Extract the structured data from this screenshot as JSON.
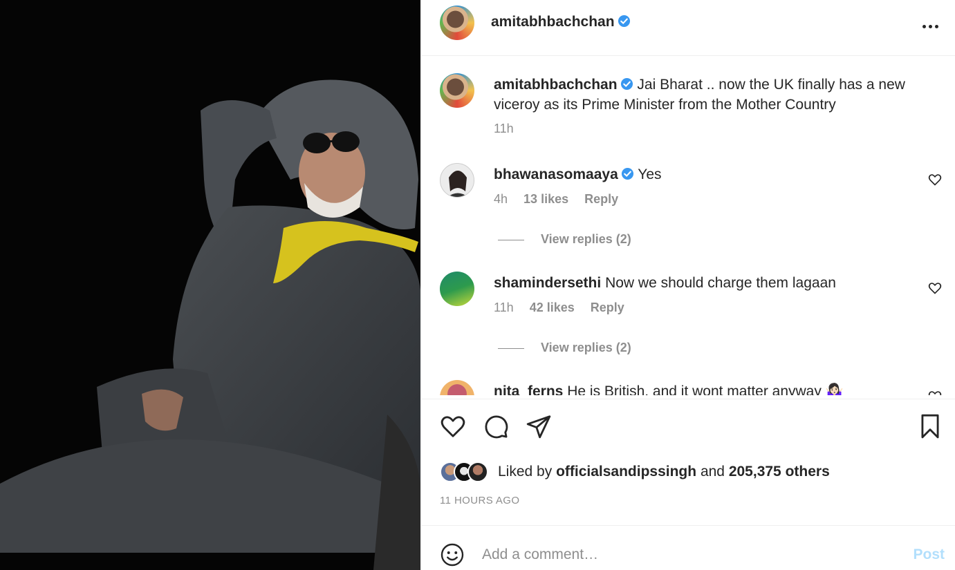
{
  "post": {
    "username": "amitabhbachchan",
    "more_icon": "more-horizontal-icon"
  },
  "caption": {
    "username": "amitabhbachchan",
    "text_line1": "Jai Bharat .. now the UK finally has a new",
    "text_line2": "viceroy as its Prime Minister from the Mother Country",
    "time": "11h"
  },
  "comments": [
    {
      "username": "bhawanasomaaya",
      "verified": true,
      "text": "Yes",
      "time": "4h",
      "likes": "13 likes",
      "reply": "Reply",
      "view_replies": "View replies (2)"
    },
    {
      "username": "shamindersethi",
      "verified": false,
      "text": "Now we should charge them lagaan",
      "time": "11h",
      "likes": "42 likes",
      "reply": "Reply",
      "view_replies": "View replies (2)"
    },
    {
      "username": "nita_ferns",
      "verified": false,
      "text": "He is British, and it wont matter anyway 🤷🏻‍♀️"
    }
  ],
  "likes": {
    "prefix": "Liked by",
    "user": "officialsandipssingh",
    "and": "and",
    "others": "205,375 others"
  },
  "timeago": "11 HOURS AGO",
  "comment_box": {
    "placeholder": "Add a comment…",
    "post_label": "Post"
  },
  "colors": {
    "verified": "#3897f0",
    "muted": "#8e8e8e",
    "post_disabled": "#b2dffc"
  }
}
